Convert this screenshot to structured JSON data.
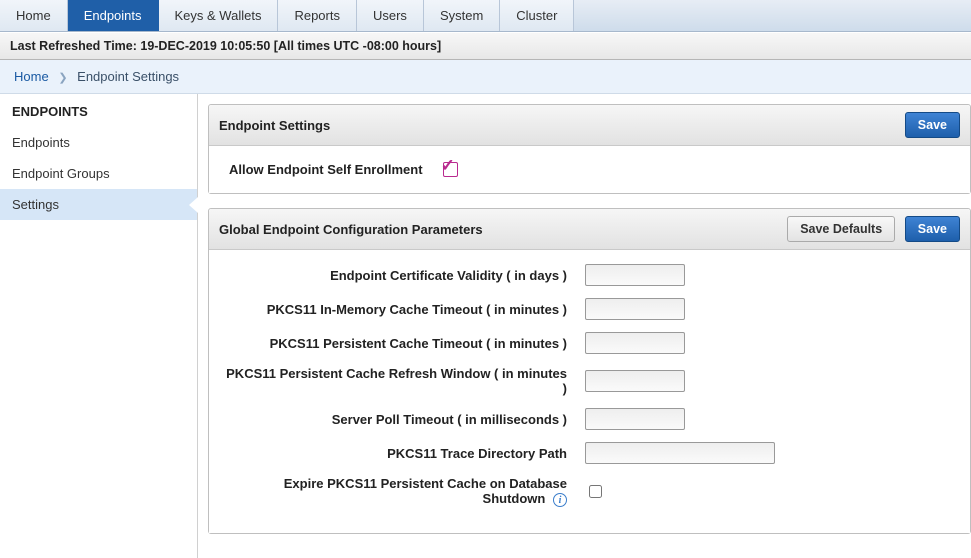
{
  "top_tabs": {
    "items": [
      "Home",
      "Endpoints",
      "Keys & Wallets",
      "Reports",
      "Users",
      "System",
      "Cluster"
    ],
    "active_index": 1
  },
  "refreshed_banner": "Last Refreshed Time: 19-DEC-2019 10:05:50 [All times UTC -08:00 hours]",
  "breadcrumb": {
    "home": "Home",
    "current": "Endpoint Settings"
  },
  "sidebar": {
    "heading": "ENDPOINTS",
    "items": [
      {
        "label": "Endpoints",
        "selected": false
      },
      {
        "label": "Endpoint Groups",
        "selected": false
      },
      {
        "label": "Settings",
        "selected": true
      }
    ]
  },
  "panels": {
    "endpoint_settings": {
      "title": "Endpoint Settings",
      "save_label": "Save",
      "allow_self_enroll_label": "Allow Endpoint Self Enrollment",
      "allow_self_enroll_checked": true
    },
    "global_params": {
      "title": "Global Endpoint Configuration Parameters",
      "save_defaults_label": "Save Defaults",
      "save_label": "Save",
      "fields": {
        "cert_validity": {
          "label": "Endpoint Certificate Validity ( in days )",
          "value": ""
        },
        "inmem_timeout": {
          "label": "PKCS11 In-Memory Cache Timeout ( in minutes )",
          "value": ""
        },
        "persist_timeout": {
          "label": "PKCS11 Persistent Cache Timeout ( in minutes )",
          "value": ""
        },
        "refresh_window": {
          "label": "PKCS11 Persistent Cache Refresh Window ( in minutes )",
          "value": ""
        },
        "poll_timeout": {
          "label": "Server Poll Timeout ( in milliseconds )",
          "value": ""
        },
        "trace_path": {
          "label": "PKCS11 Trace Directory Path",
          "value": ""
        },
        "expire_on_shutdown": {
          "label": "Expire PKCS11 Persistent Cache on Database Shutdown",
          "checked": false
        }
      }
    }
  }
}
